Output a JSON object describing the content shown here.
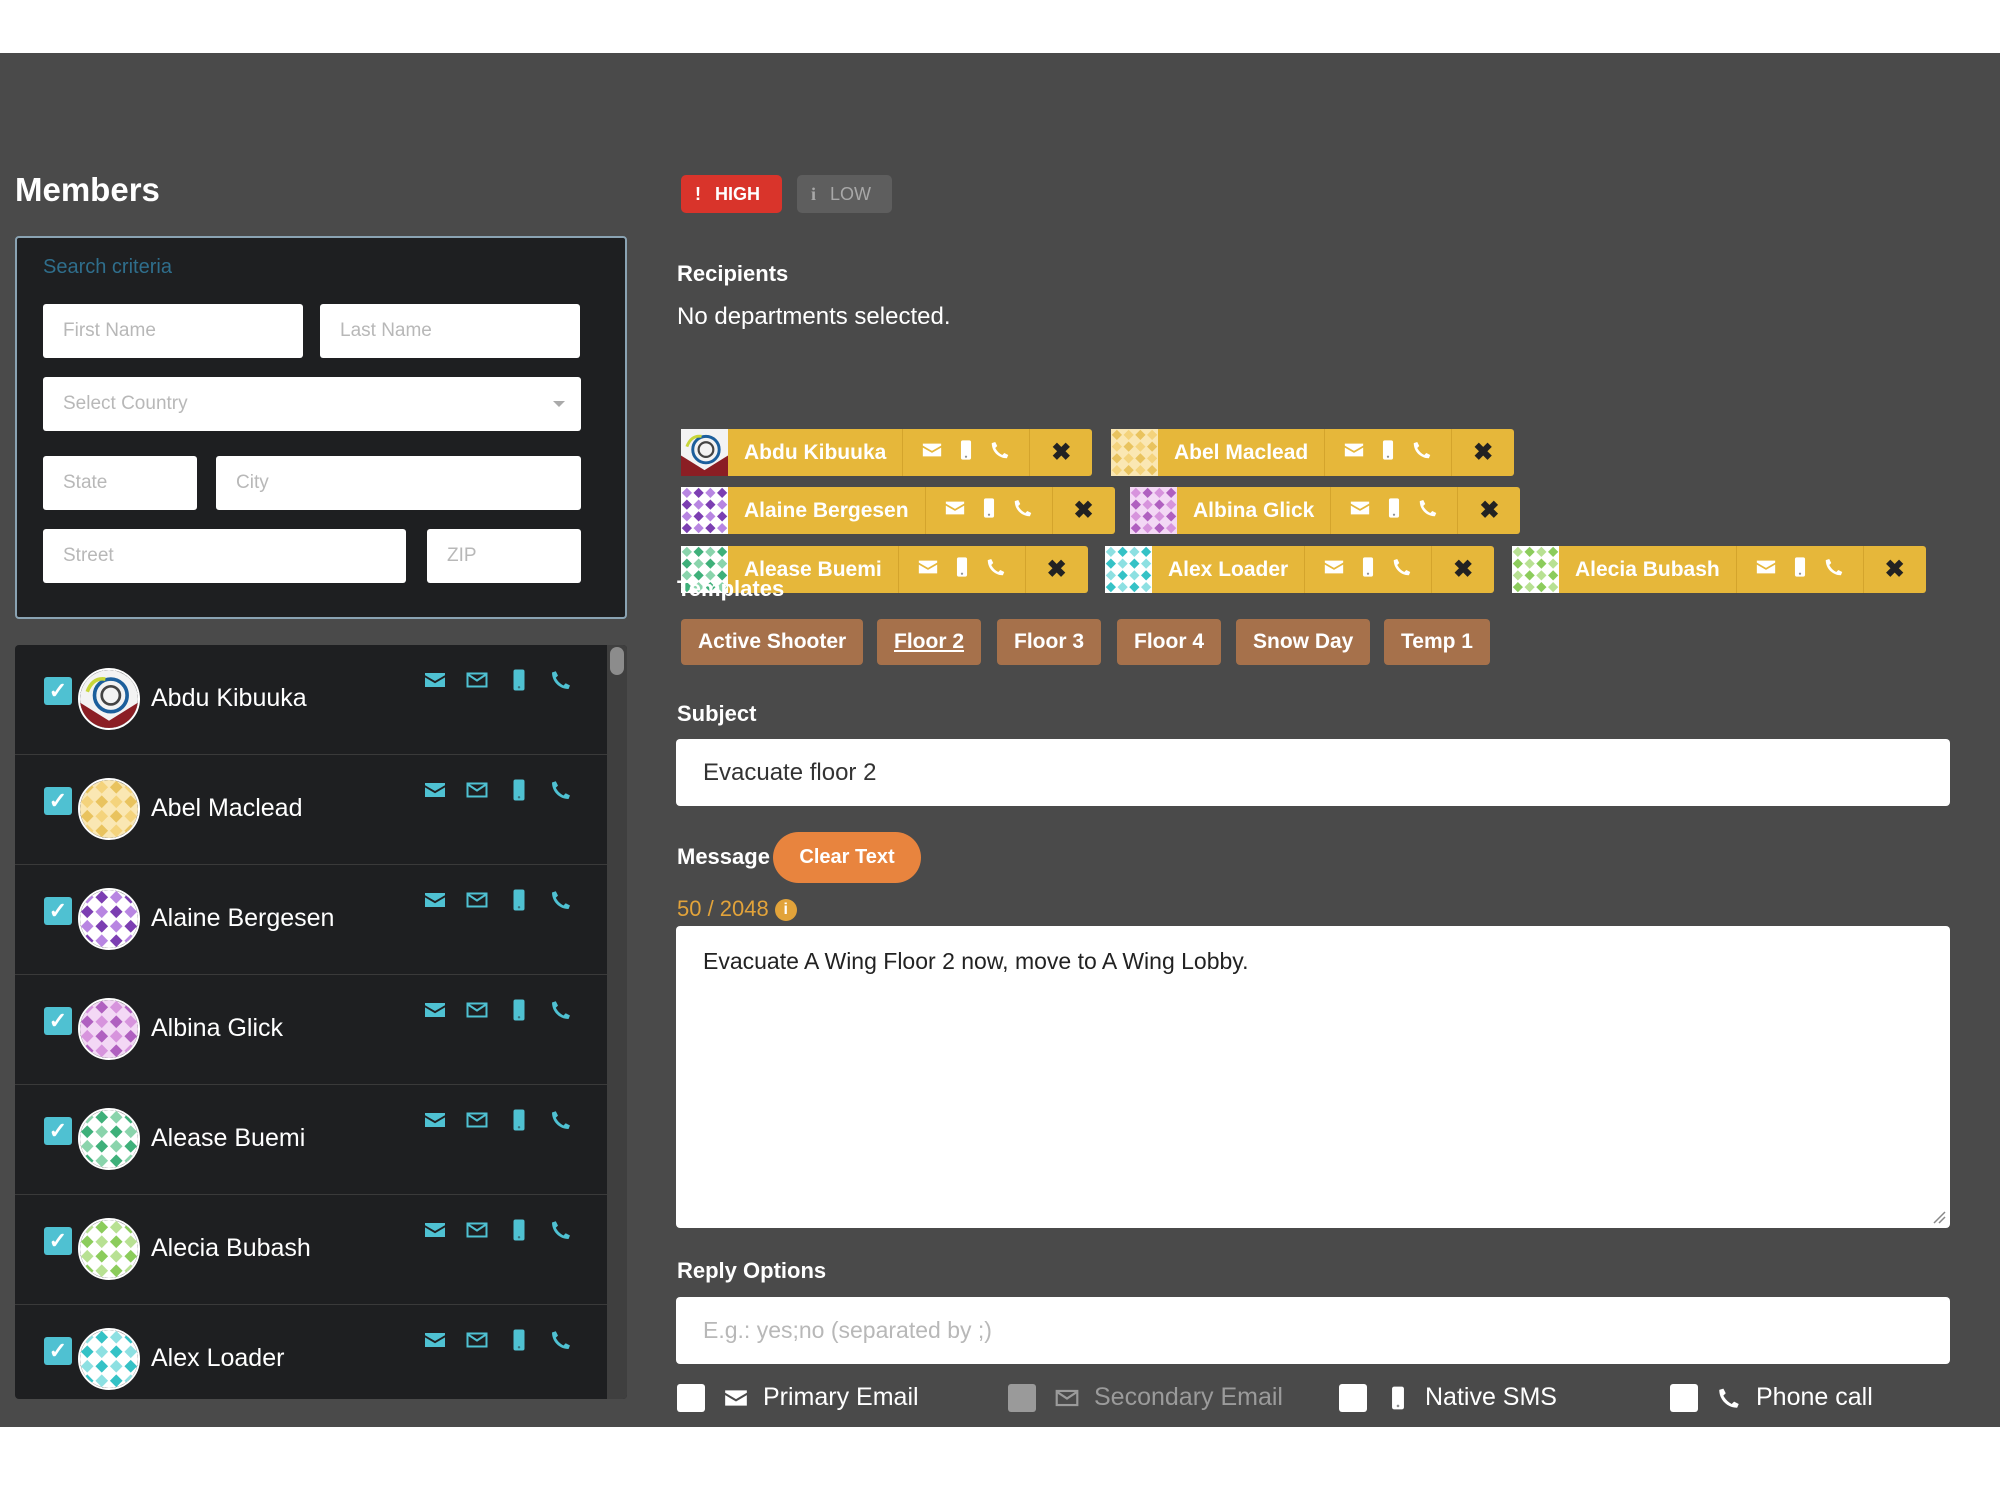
{
  "members_panel": {
    "title": "Members",
    "search": {
      "legend": "Search criteria",
      "first_name_placeholder": "First Name",
      "last_name_placeholder": "Last Name",
      "country_placeholder": "Select Country",
      "state_placeholder": "State",
      "city_placeholder": "City",
      "street_placeholder": "Street",
      "zip_placeholder": "ZIP"
    },
    "members": [
      {
        "name": "Abdu Kibuuka",
        "checked": true
      },
      {
        "name": "Abel Maclead",
        "checked": true
      },
      {
        "name": "Alaine Bergesen",
        "checked": true
      },
      {
        "name": "Albina Glick",
        "checked": true
      },
      {
        "name": "Alease Buemi",
        "checked": true
      },
      {
        "name": "Alecia Bubash",
        "checked": true
      },
      {
        "name": "Alex Loader",
        "checked": true
      }
    ],
    "icon_names": [
      "envelope-solid-icon",
      "envelope-outline-icon",
      "mobile-icon",
      "phone-icon"
    ]
  },
  "priority": {
    "high_label": "HIGH",
    "low_label": "LOW",
    "selected": "HIGH"
  },
  "recipients": {
    "label": "Recipients",
    "departments_text": "No departments selected.",
    "chips": [
      {
        "name": "Abdu Kibuuka"
      },
      {
        "name": "Abel Maclead"
      },
      {
        "name": "Alaine Bergesen"
      },
      {
        "name": "Albina Glick"
      },
      {
        "name": "Alease Buemi"
      },
      {
        "name": "Alex Loader"
      },
      {
        "name": "Alecia Bubash"
      }
    ],
    "remove_icon": "close-icon"
  },
  "templates": {
    "label": "Templates",
    "items": [
      "Active Shooter",
      "Floor 2",
      "Floor 3",
      "Floor 4",
      "Snow Day",
      "Temp 1"
    ],
    "active": "Floor 2"
  },
  "subject": {
    "label": "Subject",
    "value": "Evacuate floor 2"
  },
  "message": {
    "label": "Message",
    "clear_label": "Clear Text",
    "counter": "50 / 2048",
    "value": "Evacuate A Wing Floor 2 now, move to A Wing Lobby."
  },
  "reply": {
    "label": "Reply Options",
    "placeholder": "E.g.: yes;no (separated by ;)"
  },
  "delivery_options": [
    {
      "label": "Primary Email",
      "checked": false,
      "disabled": false
    },
    {
      "label": "Secondary Email",
      "checked": false,
      "disabled": true
    },
    {
      "label": "Native SMS",
      "checked": false,
      "disabled": false
    },
    {
      "label": "Phone call",
      "checked": false,
      "disabled": false
    }
  ],
  "colors": {
    "accent_teal": "#4fc1d2",
    "chip_yellow": "#e6b73a",
    "template_brown": "#a6714b",
    "high_red": "#d9342b",
    "clear_orange": "#e8843e"
  }
}
